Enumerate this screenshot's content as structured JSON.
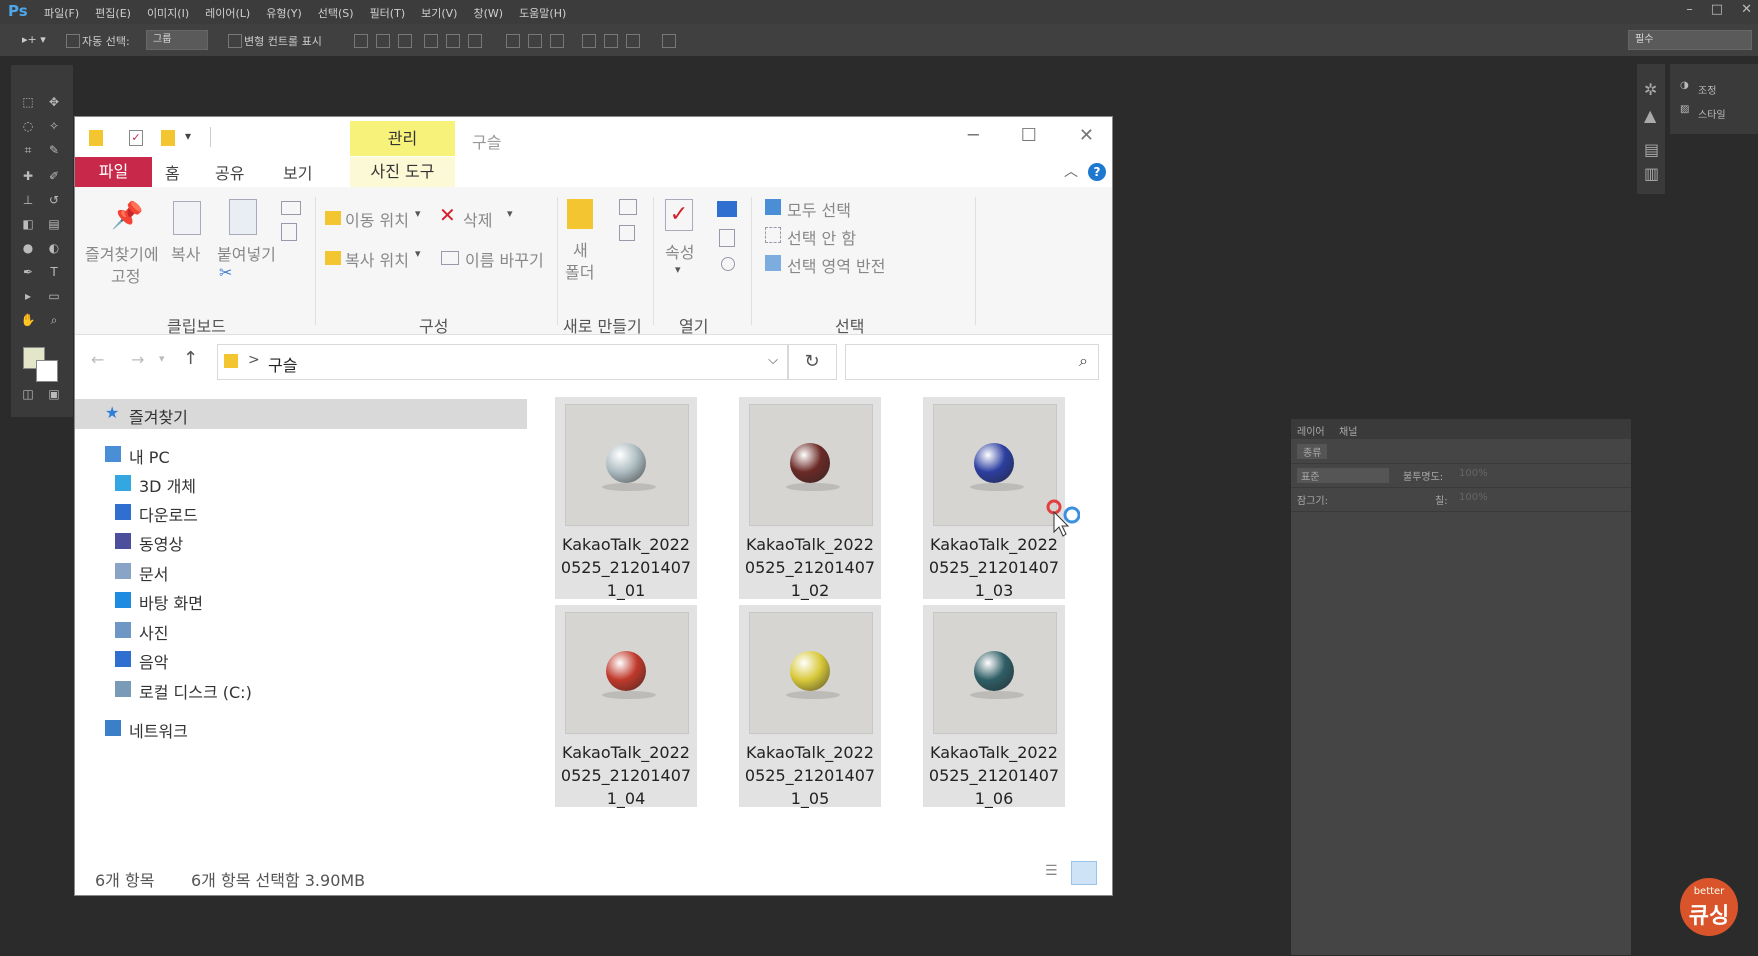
{
  "photoshop": {
    "logo": "Ps",
    "menu": [
      "파일(F)",
      "편집(E)",
      "이미지(I)",
      "레이어(L)",
      "유형(Y)",
      "선택(S)",
      "필터(T)",
      "보기(V)",
      "창(W)",
      "도움말(H)"
    ],
    "window_controls": [
      "–",
      "□",
      "✕"
    ],
    "options": {
      "auto_select_label": "자동 선택:",
      "auto_select_value": "그룹",
      "transform_controls_label": "변형 컨트롤 표시",
      "workspace_value": "필수"
    },
    "right_panel": {
      "adjust_label": "조정",
      "style_label": "스타일"
    },
    "layers_panel": {
      "tabs": [
        "레이어",
        "채널"
      ],
      "kind_label": "종류",
      "blend_mode": "표준",
      "opacity_label": "불투명도:",
      "opacity_value": "100%",
      "lock_label": "잠그기:",
      "fill_label": "칠:",
      "fill_value": "100%"
    },
    "colors": {
      "fg": "#e3e6c9",
      "bg": "#ffffff"
    }
  },
  "explorer": {
    "window_title": "구슬",
    "context_tab": "관리",
    "context_subtab": "사진 도구",
    "tabs": {
      "file": "파일",
      "home": "홈",
      "share": "공유",
      "view": "보기"
    },
    "ribbon": {
      "pin_label": "즐겨찾기에 고정",
      "pin_line1": "즐겨찾기에",
      "pin_line2": "고정",
      "copy": "복사",
      "paste": "붙여넣기",
      "clipboard_group": "클립보드",
      "move_to": "이동 위치",
      "copy_to": "복사 위치",
      "delete": "삭제",
      "rename": "이름 바꾸기",
      "organize_group": "구성",
      "new_folder_line1": "새",
      "new_folder_line2": "폴더",
      "new_group": "새로 만들기",
      "properties": "속성",
      "open_group": "열기",
      "select_all": "모두 선택",
      "select_none": "선택 안 함",
      "invert_selection": "선택 영역 반전",
      "select_group": "선택"
    },
    "address": {
      "path": "구슬",
      "separator": ">"
    },
    "nav": [
      {
        "label": "즐겨찾기",
        "icon": "star-icon",
        "indent": 0,
        "selected": true,
        "color": "#2f7fd8"
      },
      {
        "label": "내 PC",
        "icon": "pc-icon",
        "indent": 0,
        "selected": false,
        "color": "#4a8ed6"
      },
      {
        "label": "3D 개체",
        "icon": "cube-icon",
        "indent": 1,
        "selected": false,
        "color": "#35a7e0"
      },
      {
        "label": "다운로드",
        "icon": "download-icon",
        "indent": 1,
        "selected": false,
        "color": "#2f6fd0"
      },
      {
        "label": "동영상",
        "icon": "video-icon",
        "indent": 1,
        "selected": false,
        "color": "#4b4f9c"
      },
      {
        "label": "문서",
        "icon": "document-icon",
        "indent": 1,
        "selected": false,
        "color": "#8aa4c8"
      },
      {
        "label": "바탕 화면",
        "icon": "desktop-icon",
        "indent": 1,
        "selected": false,
        "color": "#1f8be0"
      },
      {
        "label": "사진",
        "icon": "pictures-icon",
        "indent": 1,
        "selected": false,
        "color": "#6f97c5"
      },
      {
        "label": "음악",
        "icon": "music-icon",
        "indent": 1,
        "selected": false,
        "color": "#2f6fd0"
      },
      {
        "label": "로컬 디스크 (C:)",
        "icon": "disk-icon",
        "indent": 1,
        "selected": false,
        "color": "#7a9bb8"
      },
      {
        "label": "네트워크",
        "icon": "network-icon",
        "indent": 0,
        "selected": false,
        "color": "#3a7fc8"
      }
    ],
    "files": [
      {
        "name": "KakaoTalk_20220525_212014071_01",
        "marble_color": "#aebdc2"
      },
      {
        "name": "KakaoTalk_20220525_212014071_02",
        "marble_color": "#6b2a26"
      },
      {
        "name": "KakaoTalk_20220525_212014071_03",
        "marble_color": "#2c3fa0"
      },
      {
        "name": "KakaoTalk_20220525_212014071_04",
        "marble_color": "#c0392b"
      },
      {
        "name": "KakaoTalk_20220525_212014071_05",
        "marble_color": "#d8c93a"
      },
      {
        "name": "KakaoTalk_20220525_212014071_06",
        "marble_color": "#2f5e66"
      }
    ],
    "status": {
      "count": "6개 항목",
      "selection": "6개 항목 선택함 3.90MB"
    }
  },
  "badge": {
    "small": "better",
    "big": "큐싱"
  }
}
